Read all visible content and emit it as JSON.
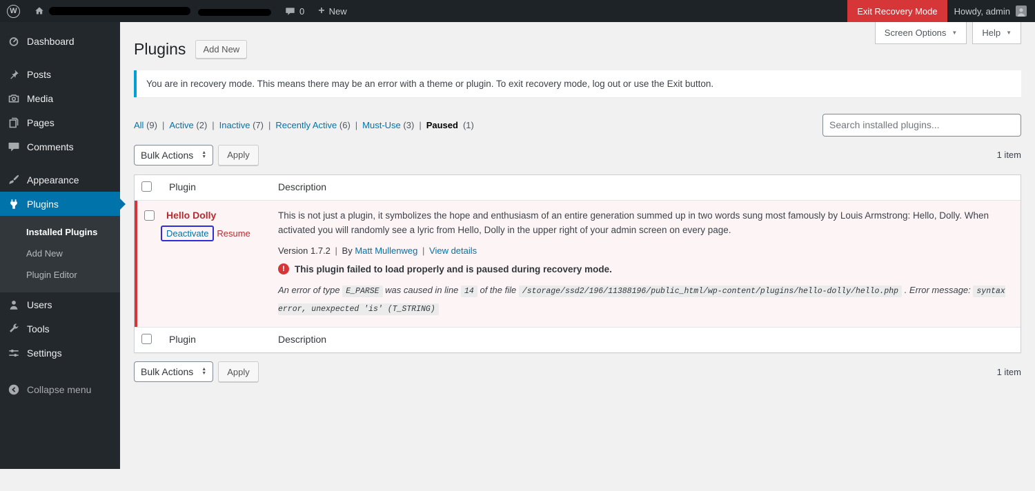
{
  "colors": {
    "accent_blue": "#0073aa",
    "recovery_red": "#d63638",
    "paused_text_red": "#b32d2e",
    "deactivate_highlight_box": "#2d2ed8",
    "notice_info_blue": "#00a0d2"
  },
  "admin_bar": {
    "comments_count": "0",
    "new_label": "New",
    "exit_recovery_label": "Exit Recovery Mode",
    "howdy_label": "Howdy, admin"
  },
  "sidebar": {
    "items": [
      {
        "label": "Dashboard"
      },
      {
        "label": "Posts"
      },
      {
        "label": "Media"
      },
      {
        "label": "Pages"
      },
      {
        "label": "Comments"
      },
      {
        "label": "Appearance"
      },
      {
        "label": "Plugins"
      },
      {
        "label": "Users"
      },
      {
        "label": "Tools"
      },
      {
        "label": "Settings"
      }
    ],
    "plugins_submenu": [
      {
        "label": "Installed Plugins"
      },
      {
        "label": "Add New"
      },
      {
        "label": "Plugin Editor"
      }
    ],
    "collapse_label": "Collapse menu"
  },
  "page": {
    "title": "Plugins",
    "add_new_label": "Add New",
    "screen_options_label": "Screen Options",
    "help_label": "Help",
    "notice_text": "You are in recovery mode. This means there may be an error with a theme or plugin. To exit recovery mode, log out or use the Exit button.",
    "item_count": "1 item"
  },
  "filters": {
    "separator": "|",
    "items": [
      {
        "label": "All",
        "count": "(9)"
      },
      {
        "label": "Active",
        "count": "(2)"
      },
      {
        "label": "Inactive",
        "count": "(7)"
      },
      {
        "label": "Recently Active",
        "count": "(6)"
      },
      {
        "label": "Must-Use",
        "count": "(3)"
      },
      {
        "label": "Paused",
        "count": "(1)"
      }
    ]
  },
  "search": {
    "placeholder": "Search installed plugins..."
  },
  "bulk": {
    "label": "Bulk Actions",
    "apply_label": "Apply"
  },
  "table": {
    "plugin_column": "Plugin",
    "description_column": "Description",
    "row": {
      "name": "Hello Dolly",
      "deactivate_label": "Deactivate",
      "resume_label": "Resume",
      "description": "This is not just a plugin, it symbolizes the hope and enthusiasm of an entire generation summed up in two words sung most famously by Louis Armstrong: Hello, Dolly. When activated you will randomly see a lyric from Hello, Dolly in the upper right of your admin screen on every page.",
      "version_label": "Version 1.7.2",
      "separator": "|",
      "by_label": "By",
      "author": "Matt Mullenweg",
      "view_details_label": "View details",
      "paused_message": "This plugin failed to load properly and is paused during recovery mode.",
      "error": {
        "part1": "An error of type",
        "code1": "E_PARSE",
        "part2": "was caused in line",
        "code2": "14",
        "part3": "of the file",
        "code3": "/storage/ssd2/196/11388196/public_html/wp-content/plugins/hello-dolly/hello.php",
        "part4": ". Error message:",
        "code4": "syntax error, unexpected 'is' (T_STRING)"
      }
    }
  }
}
